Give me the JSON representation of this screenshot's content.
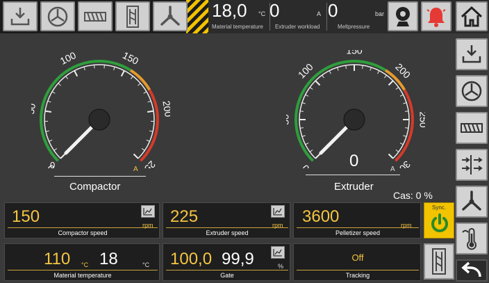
{
  "topbar": {
    "material_temperature": {
      "value": "18,0",
      "unit": "°C",
      "label": "Material temperature"
    },
    "extruder_workload": {
      "value": "0",
      "unit": "A",
      "label": "Extruder workload"
    },
    "melt_pressure": {
      "value": "0",
      "unit": "bar",
      "label": "Meltpressure"
    }
  },
  "compactor_gauge": {
    "label": "Compactor",
    "value": "0",
    "unit": "A",
    "max": 250,
    "ticks": [
      "0",
      "50",
      "100",
      "150",
      "200",
      "250"
    ]
  },
  "extruder_gauge": {
    "label": "Extruder",
    "value": "0",
    "unit": "A",
    "max": 300,
    "ticks": [
      "0",
      "50",
      "100",
      "150",
      "200",
      "250",
      "300"
    ]
  },
  "cas": "Cas: 0 %",
  "panels": {
    "compactor_speed": {
      "value": "150",
      "unit": "rpm",
      "label": "Compactor speed"
    },
    "extruder_speed": {
      "value": "225",
      "unit": "rpm",
      "label": "Extruder speed"
    },
    "pelletizer_speed": {
      "value": "3600",
      "unit": "rpm",
      "label": "Pelletizer speed"
    },
    "material_temperature": {
      "setpoint": "110",
      "setpoint_unit": "°C",
      "actual": "18",
      "actual_unit": "°C",
      "label": "Material temperature"
    },
    "gate": {
      "setpoint": "100,0",
      "actual": "99,9",
      "unit": "%",
      "label": "Gate"
    },
    "tracking": {
      "value": "Off",
      "label": "Tracking"
    }
  },
  "sync": {
    "label": "Sync."
  },
  "colors": {
    "accent": "#f4c542",
    "alarm": "#e53935",
    "gauge_green": "#2e9e3c",
    "gauge_orange": "#e89a2c",
    "gauge_red": "#d63a2a"
  }
}
